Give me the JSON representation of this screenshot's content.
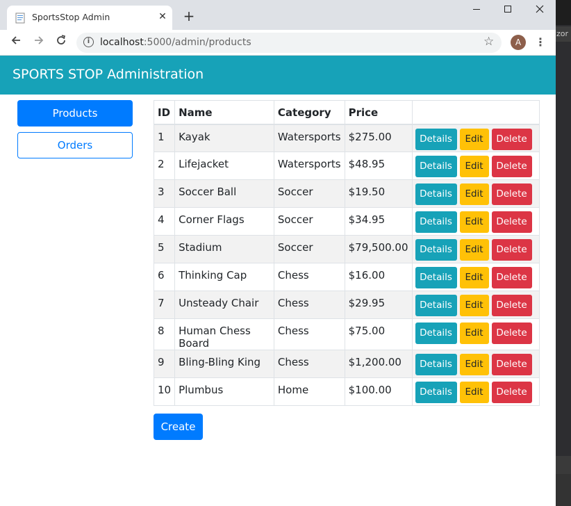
{
  "browser": {
    "tab_title": "SportsStop Admin",
    "new_tab_symbol": "+",
    "url_host": "localhost",
    "url_path": ":5000/admin/products",
    "profile_initial": "A",
    "side_tag": "zor"
  },
  "app": {
    "title": "SPORTS STOP Administration",
    "accent_color": "#17a2b8"
  },
  "sidebar": {
    "items": [
      {
        "label": "Products",
        "active": true
      },
      {
        "label": "Orders",
        "active": false
      }
    ]
  },
  "table": {
    "headers": [
      "ID",
      "Name",
      "Category",
      "Price",
      ""
    ],
    "action_labels": {
      "details": "Details",
      "edit": "Edit",
      "delete": "Delete"
    },
    "rows": [
      {
        "id": "1",
        "name": "Kayak",
        "category": "Watersports",
        "price": "$275.00"
      },
      {
        "id": "2",
        "name": "Lifejacket",
        "category": "Watersports",
        "price": "$48.95"
      },
      {
        "id": "3",
        "name": "Soccer Ball",
        "category": "Soccer",
        "price": "$19.50"
      },
      {
        "id": "4",
        "name": "Corner Flags",
        "category": "Soccer",
        "price": "$34.95"
      },
      {
        "id": "5",
        "name": "Stadium",
        "category": "Soccer",
        "price": "$79,500.00"
      },
      {
        "id": "6",
        "name": "Thinking Cap",
        "category": "Chess",
        "price": "$16.00"
      },
      {
        "id": "7",
        "name": "Unsteady Chair",
        "category": "Chess",
        "price": "$29.95"
      },
      {
        "id": "8",
        "name": "Human Chess Board",
        "category": "Chess",
        "price": "$75.00"
      },
      {
        "id": "9",
        "name": "Bling-Bling King",
        "category": "Chess",
        "price": "$1,200.00"
      },
      {
        "id": "10",
        "name": "Plumbus",
        "category": "Home",
        "price": "$100.00"
      }
    ]
  },
  "create_label": "Create"
}
